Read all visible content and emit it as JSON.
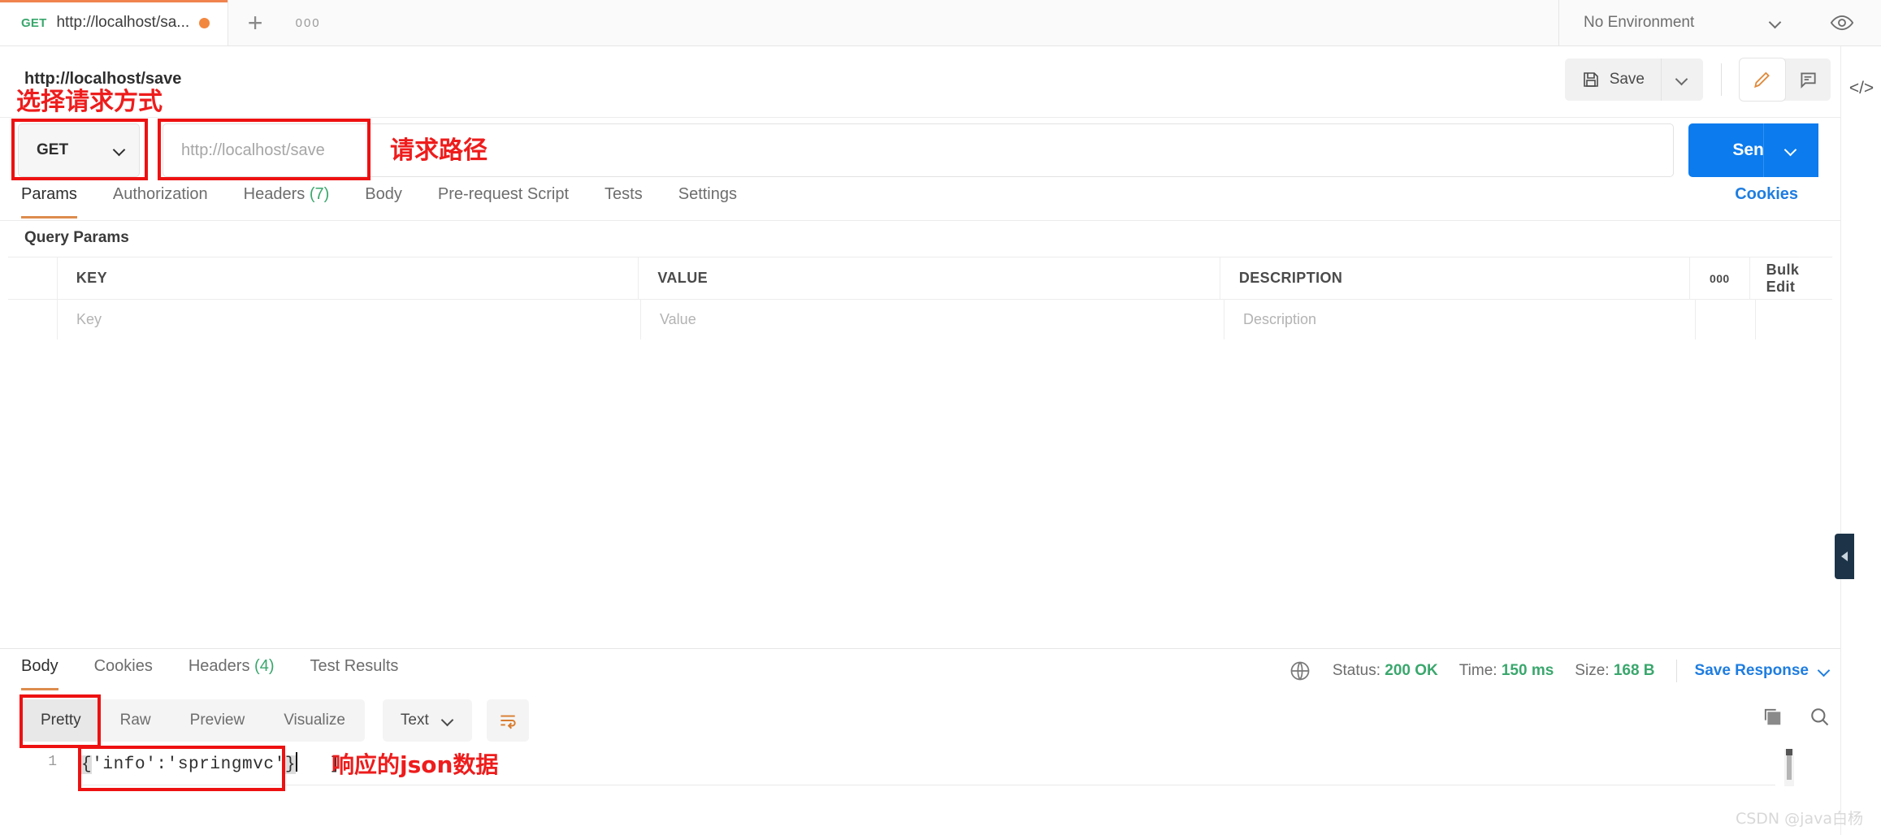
{
  "tabbar": {
    "tab_method": "GET",
    "tab_title": "http://localhost/sa...",
    "new_tab_label": "+",
    "more_tabs_label": "000",
    "environment_label": "No Environment"
  },
  "request": {
    "name": "http://localhost/save",
    "save_label": "Save",
    "method": "GET",
    "url_placeholder": "http://localhost/save",
    "send_label": "Send",
    "tabs": [
      {
        "label": "Params",
        "count": "",
        "active": true
      },
      {
        "label": "Authorization",
        "count": "",
        "active": false
      },
      {
        "label": "Headers",
        "count": "(7)",
        "active": false
      },
      {
        "label": "Body",
        "count": "",
        "active": false
      },
      {
        "label": "Pre-request Script",
        "count": "",
        "active": false
      },
      {
        "label": "Tests",
        "count": "",
        "active": false
      },
      {
        "label": "Settings",
        "count": "",
        "active": false
      }
    ],
    "cookies_link": "Cookies"
  },
  "params": {
    "section_label": "Query Params",
    "columns": [
      "KEY",
      "VALUE",
      "DESCRIPTION"
    ],
    "more_label": "000",
    "bulk_edit_label": "Bulk Edit",
    "rows": [
      {
        "key": "Key",
        "value": "Value",
        "description": "Description"
      }
    ]
  },
  "response": {
    "tabs": [
      {
        "label": "Body",
        "count": "",
        "active": true
      },
      {
        "label": "Cookies",
        "count": "",
        "active": false
      },
      {
        "label": "Headers",
        "count": "(4)",
        "active": false
      },
      {
        "label": "Test Results",
        "count": "",
        "active": false
      }
    ],
    "status_label": "Status:",
    "status_value": "200 OK",
    "time_label": "Time:",
    "time_value": "150 ms",
    "size_label": "Size:",
    "size_value": "168 B",
    "save_response_label": "Save Response",
    "formats": [
      {
        "label": "Pretty",
        "active": true
      },
      {
        "label": "Raw",
        "active": false
      },
      {
        "label": "Preview",
        "active": false
      },
      {
        "label": "Visualize",
        "active": false
      }
    ],
    "content_type": "Text",
    "line_number": "1",
    "body_prefix": "'info':'springmvc'",
    "body_open_brace": "{",
    "body_close_brace": "}",
    "body_trailing": "   ]"
  },
  "annotations": {
    "method_note": "选择请求方式",
    "url_note": "请求路径",
    "json_note": "响应的json数据"
  },
  "colors": {
    "accent_blue": "#0b7bed",
    "green": "#3aa76d",
    "orange": "#f0834e",
    "annotation_red": "#ee1111"
  },
  "watermark": "CSDN @java白杨"
}
